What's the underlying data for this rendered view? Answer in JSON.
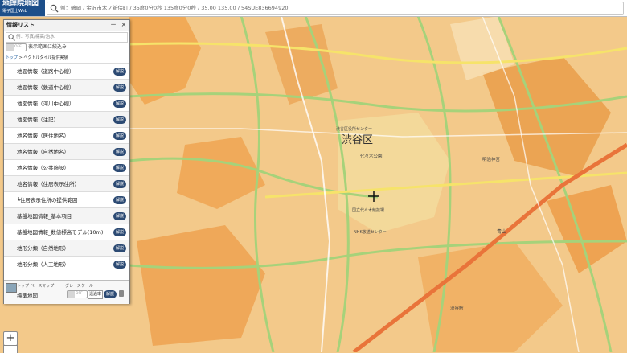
{
  "app": {
    "logo_title": "地理院地図",
    "logo_subtitle": "電子国土Web"
  },
  "search": {
    "placeholder": "例：鶴岡 / 金沢市木ノ新保町 / 35度0分0秒 135度0分0秒 / 35.00 135.00 / 54SUE836694920"
  },
  "panel": {
    "title": "情報リスト",
    "minimize_label": "－",
    "close_label": "×",
    "filter_placeholder": "例：写真/標高/治水",
    "range_toggle": "OFF",
    "range_label": "表示範囲に絞込み",
    "breadcrumb_top": "トップ",
    "breadcrumb_sep": " > ",
    "breadcrumb_current": "ベクトルタイル提供実験",
    "items": [
      {
        "label": "地図情報（道路中心線）",
        "button": "解説"
      },
      {
        "label": "地図情報（鉄道中心線）",
        "button": "解説"
      },
      {
        "label": "地図情報（河川中心線）",
        "button": "解説"
      },
      {
        "label": "地図情報（注記）",
        "button": "解説"
      },
      {
        "label": "地名情報（居住地名）",
        "button": "解説"
      },
      {
        "label": "地名情報（自然地名）",
        "button": "解説"
      },
      {
        "label": "地名情報（公共施設）",
        "button": "解説"
      },
      {
        "label": "地名情報（住居表示住所）",
        "button": "解説"
      },
      {
        "label": "┗住居表示住所の提供範囲",
        "button": "解説"
      },
      {
        "label": "基盤地図情報_基本項目",
        "button": "解説"
      },
      {
        "label": "基盤地図情報_数値標高モデル(10m)",
        "button": "解説"
      },
      {
        "label": "地形分類（自然地形）",
        "button": "解説"
      },
      {
        "label": "地形分類（人工地形）",
        "button": "解説"
      }
    ],
    "basemap": {
      "tag": "トップ ベースマップ",
      "name": "標準地図",
      "grayscale_label": "グレースケール",
      "grayscale_toggle": "OFF",
      "opacity_button": "透過率",
      "info_button": "解説"
    }
  },
  "map": {
    "ward_name": "渋谷区",
    "labels": {
      "city_center": "渋谷区役所センター",
      "yoyogi_park": "代々木公園",
      "olympic": "国立代々木競技場",
      "nhk": "NHK放送センター",
      "jingu": "明治神宮",
      "aoyama": "青山",
      "shibuya_st": "渋谷駅"
    }
  },
  "zoom": {
    "in": "+"
  }
}
